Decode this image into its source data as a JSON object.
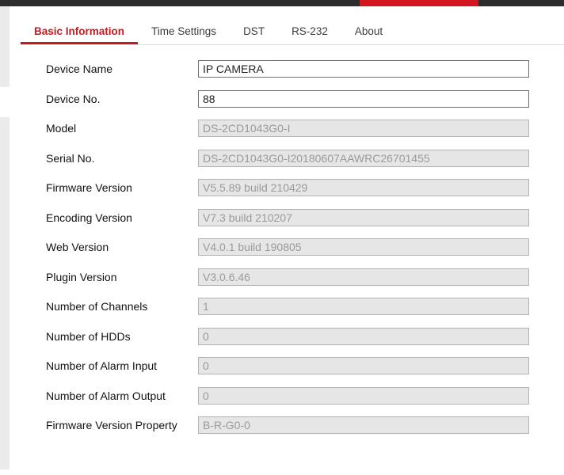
{
  "top_bar": {
    "bar_color": "#2d2d2d",
    "accent_color": "#d3161d"
  },
  "tabs": {
    "active_color": "#c41a21",
    "items": [
      {
        "label": "Basic Information",
        "active": true
      },
      {
        "label": "Time Settings",
        "active": false
      },
      {
        "label": "DST",
        "active": false
      },
      {
        "label": "RS-232",
        "active": false
      },
      {
        "label": "About",
        "active": false
      }
    ]
  },
  "form": {
    "fields": [
      {
        "label": "Device Name",
        "value": "IP CAMERA",
        "editable": true
      },
      {
        "label": "Device No.",
        "value": "88",
        "editable": true
      },
      {
        "label": "Model",
        "value": "DS-2CD1043G0-I",
        "editable": false
      },
      {
        "label": "Serial No.",
        "value": "DS-2CD1043G0-I20180607AAWRC26701455",
        "editable": false
      },
      {
        "label": "Firmware Version",
        "value": "V5.5.89 build 210429",
        "editable": false
      },
      {
        "label": "Encoding Version",
        "value": "V7.3 build 210207",
        "editable": false
      },
      {
        "label": "Web Version",
        "value": "V4.0.1 build 190805",
        "editable": false
      },
      {
        "label": "Plugin Version",
        "value": "V3.0.6.46",
        "editable": false
      },
      {
        "label": "Number of Channels",
        "value": "1",
        "editable": false
      },
      {
        "label": "Number of HDDs",
        "value": "0",
        "editable": false
      },
      {
        "label": "Number of Alarm Input",
        "value": "0",
        "editable": false
      },
      {
        "label": "Number of Alarm Output",
        "value": "0",
        "editable": false
      },
      {
        "label": "Firmware Version Property",
        "value": "B-R-G0-0",
        "editable": false
      }
    ]
  },
  "colors": {
    "readonly_field_bg": "#e6e6e6",
    "readonly_field_text": "#9a9a9a",
    "tab_inactive_text": "#3c3c3c",
    "sidebar_edge": "#ebebeb"
  }
}
